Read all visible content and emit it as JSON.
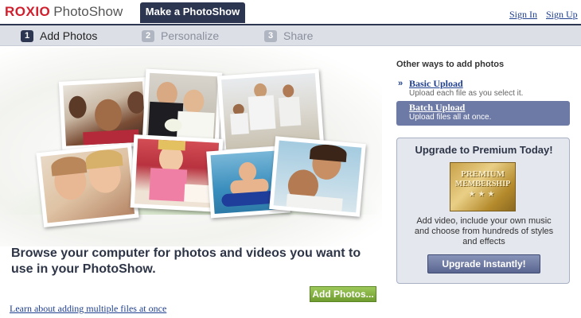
{
  "header": {
    "brand": "ROXIO",
    "product": "PhotoShow",
    "active_tab": "Make a PhotoShow",
    "sign_in": "Sign In",
    "sign_up": "Sign Up"
  },
  "steps": [
    {
      "number": "1",
      "label": "Add Photos"
    },
    {
      "number": "2",
      "label": "Personalize"
    },
    {
      "number": "3",
      "label": "Share"
    }
  ],
  "main": {
    "browse_text": "Browse your computer for photos and videos you want to use in your PhotoShow.",
    "add_button": "Add Photos...",
    "learn_link": "Learn about adding multiple files at once"
  },
  "sidebar": {
    "heading": "Other ways to add photos",
    "options": [
      {
        "title": "Basic Upload",
        "desc": "Upload each file as you select it."
      },
      {
        "title": "Batch Upload",
        "desc": "Upload files all at once."
      }
    ]
  },
  "premium": {
    "heading": "Upgrade to Premium Today!",
    "badge_line1": "PREMIUM",
    "badge_line2": "MEMBERSHIP",
    "badge_stars": "★★★",
    "description": "Add video, include your own music and choose from hundreds of styles and effects",
    "button": "Upgrade Instantly!"
  },
  "colors": {
    "nav_dark": "#2c3650",
    "link_blue": "#1f3f8f",
    "brand_red": "#d0202e",
    "add_green": "#7aa83a",
    "batch_highlight": "#6d7aa5"
  }
}
